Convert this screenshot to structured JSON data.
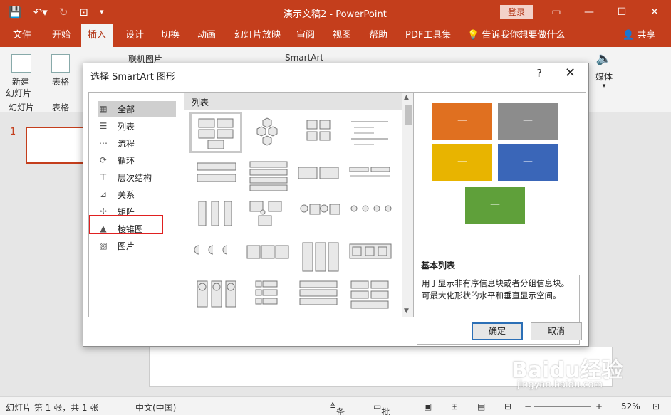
{
  "titlebar": {
    "doc_title": "演示文稿2  -  PowerPoint",
    "login": "登录"
  },
  "tabs": [
    "文件",
    "开始",
    "插入",
    "设计",
    "切换",
    "动画",
    "幻灯片放映",
    "审阅",
    "视图",
    "帮助",
    "PDF工具集",
    "告诉我你想要做什么",
    "共享"
  ],
  "active_tab": "插入",
  "ribbon": {
    "new_slide": "新建",
    "new_slide_2": "幻灯片",
    "slides_group": "幻灯片",
    "table": "表格",
    "table_group": "表格",
    "online_pictures": "联机图片",
    "smartart": "SmartArt",
    "media": "媒体"
  },
  "slide_panel": {
    "number": "1"
  },
  "dialog": {
    "title": "选择 SmartArt 图形",
    "help": "?",
    "close": "✕",
    "categories": [
      {
        "label": "全部",
        "icon": "all-icon"
      },
      {
        "label": "列表",
        "icon": "list-icon"
      },
      {
        "label": "流程",
        "icon": "process-icon"
      },
      {
        "label": "循环",
        "icon": "cycle-icon"
      },
      {
        "label": "层次结构",
        "icon": "hierarchy-icon"
      },
      {
        "label": "关系",
        "icon": "relationship-icon"
      },
      {
        "label": "矩阵",
        "icon": "matrix-icon"
      },
      {
        "label": "棱锥图",
        "icon": "pyramid-icon"
      },
      {
        "label": "图片",
        "icon": "picture-icon"
      }
    ],
    "gallery_header": "列表",
    "preview": {
      "box_text": "—",
      "colors": [
        "#e07020",
        "#8c8c8c",
        "#e8b400",
        "#3a66b8",
        "#5fa03a"
      ],
      "name": "基本列表",
      "description": "用于显示非有序信息块或者分组信息块。可最大化形状的水平和垂直显示空间。"
    },
    "ok": "确定",
    "cancel": "取消"
  },
  "statusbar": {
    "slide_info": "幻灯片 第 1 张，共 1 张",
    "language": "中文(中国)",
    "notes": "备注",
    "comments": "批注",
    "zoom": "52%"
  },
  "watermark": {
    "logo": "Baidu经验",
    "url": "jingyan.baidu.com"
  }
}
